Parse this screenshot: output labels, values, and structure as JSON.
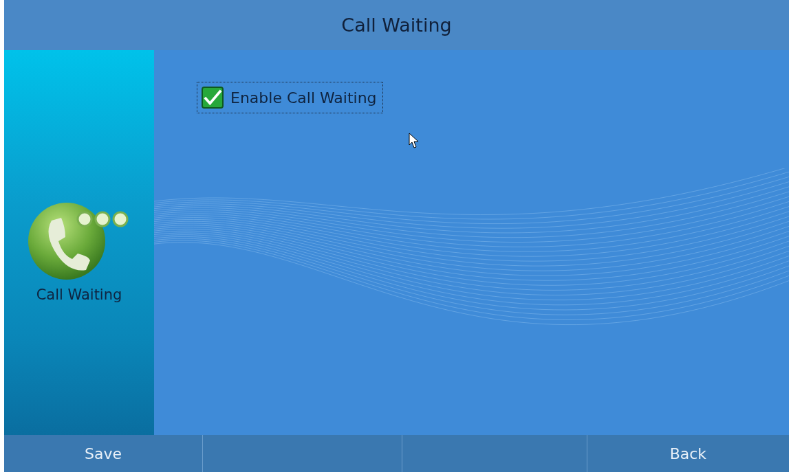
{
  "window": {
    "title": "Call Waiting"
  },
  "sidebar": {
    "label": "Call Waiting"
  },
  "options": [
    {
      "label": "Enable Call Waiting",
      "checked": true,
      "focused": true
    }
  ],
  "soft_keys": [
    {
      "kind": "text",
      "label": "Save"
    },
    {
      "kind": "blank"
    },
    {
      "kind": "blank"
    },
    {
      "kind": "text",
      "label": "Back"
    }
  ]
}
